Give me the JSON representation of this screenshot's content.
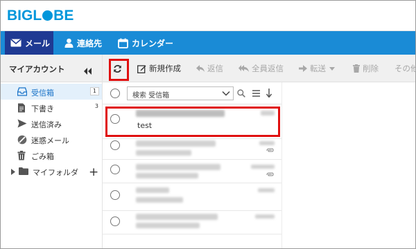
{
  "logo": {
    "prefix": "BIGL",
    "suffix": "BE"
  },
  "nav": {
    "mail": "メール",
    "contacts": "連絡先",
    "calendar": "カレンダー"
  },
  "sidebar": {
    "account_title": "マイアカウント",
    "folders": [
      {
        "label": "受信箱",
        "count": "1"
      },
      {
        "label": "下書き",
        "count": "3"
      },
      {
        "label": "送信済み",
        "count": ""
      },
      {
        "label": "迷惑メール",
        "count": ""
      },
      {
        "label": "ごみ箱",
        "count": ""
      },
      {
        "label": "マイフォルダ",
        "count": ""
      }
    ],
    "add_label": "+"
  },
  "toolbar": {
    "new": "新規作成",
    "reply": "返信",
    "reply_all": "全員返信",
    "forward": "転送",
    "delete": "削除",
    "other": "その他"
  },
  "list": {
    "search_label": "検索 受信箱",
    "messages": [
      {
        "preview": "test"
      }
    ]
  },
  "colors": {
    "nav_bg": "#1a8bd6",
    "nav_active": "#1f3a93",
    "highlight": "#e01010",
    "logo": "#0096db"
  }
}
